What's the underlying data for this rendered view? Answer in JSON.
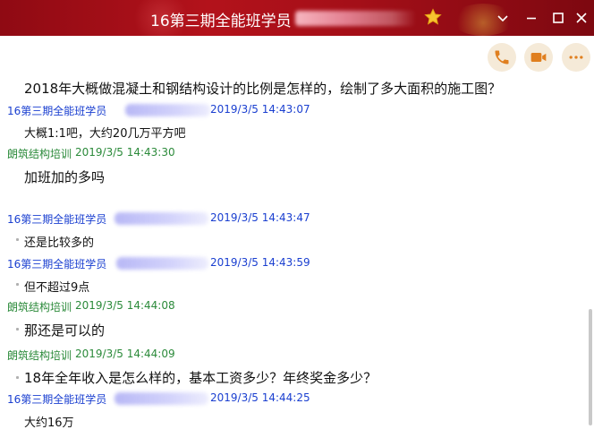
{
  "window": {
    "title": "16第三期全能班学员",
    "accent_color": "#a40f18"
  },
  "toolbar": {
    "buttons": [
      "phone-icon",
      "video-icon",
      "more-icon"
    ]
  },
  "messages": [
    {
      "text": "2018年大概做混凝土和钢结构设计的比例是怎样的，绘制了多大面积的施工图？"
    },
    {
      "sender": "16第三期全能班学员",
      "time": "2019/3/5 14:43:07",
      "text": "大概1:1吧，大约20几万平方吧"
    },
    {
      "sender": "朗筑结构培训",
      "time": "2019/3/5 14:43:30",
      "text": "加班加的多吗"
    },
    {
      "sender": "16第三期全能班学员",
      "time": "2019/3/5 14:43:47",
      "text": "还是比较多的"
    },
    {
      "sender": "16第三期全能班学员",
      "time": "2019/3/5 14:43:59",
      "text": "但不超过9点"
    },
    {
      "sender": "朗筑结构培训",
      "time": "2019/3/5 14:44:08",
      "text": "那还是可以的"
    },
    {
      "sender": "朗筑结构培训",
      "time": "2019/3/5 14:44:09",
      "text": "18年全年收入是怎么样的，基本工资多少？年终奖金多少？"
    },
    {
      "sender": "16第三期全能班学员",
      "time": "2019/3/5 14:44:25",
      "text": "大约16万"
    }
  ]
}
